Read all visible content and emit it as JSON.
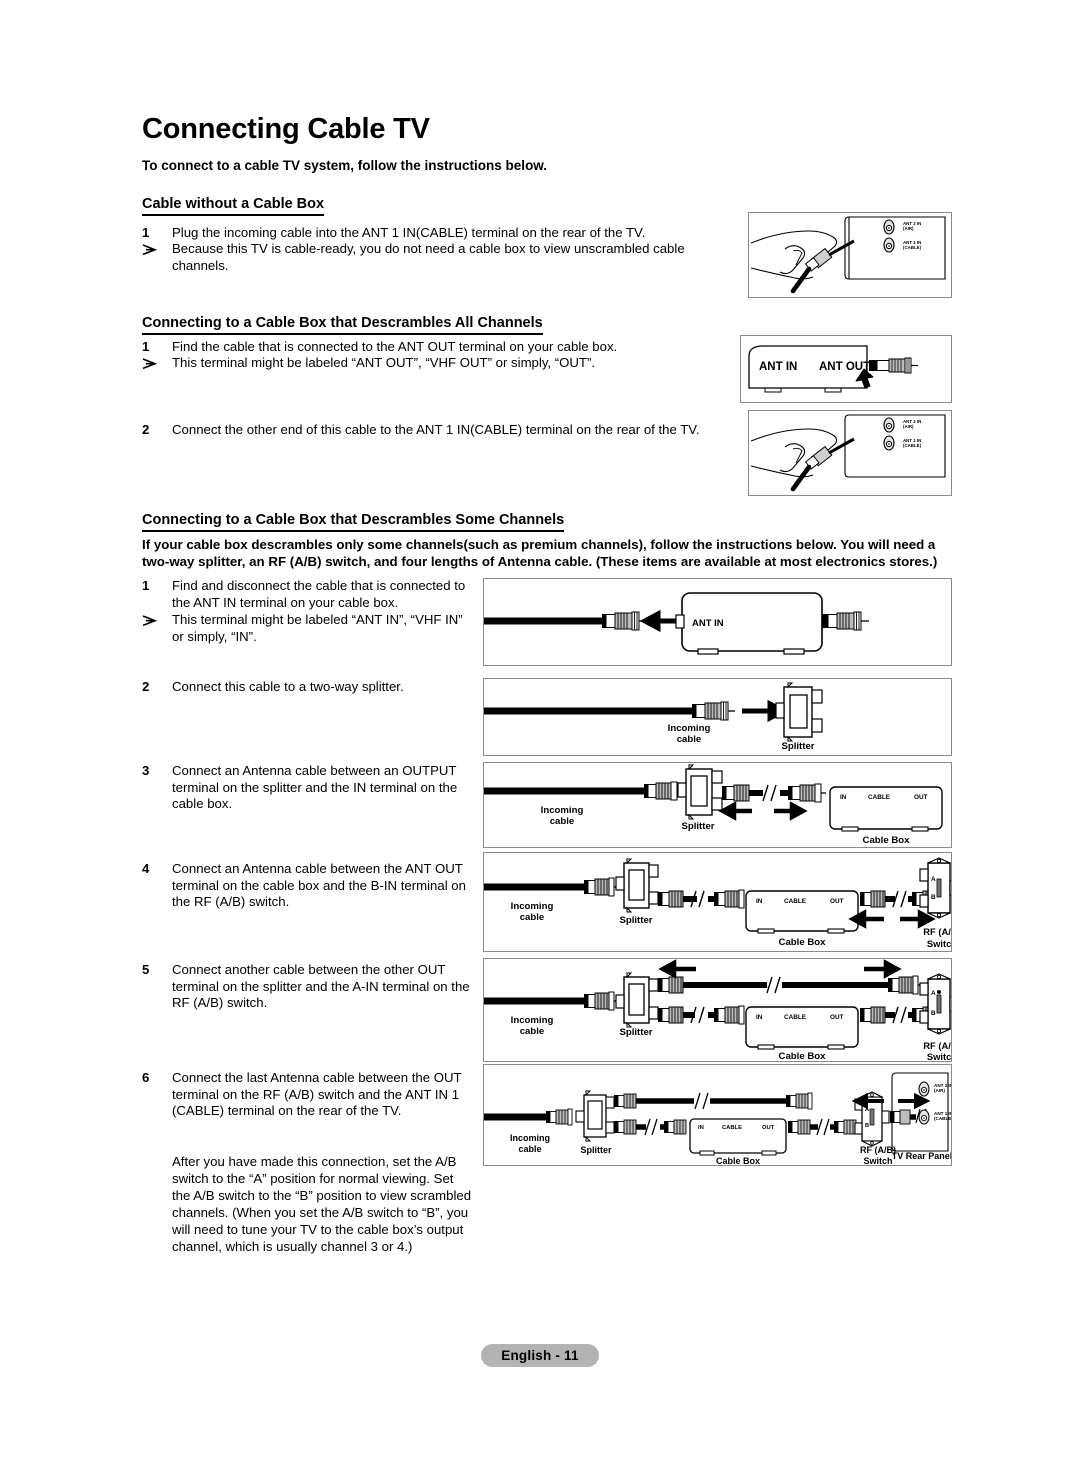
{
  "document": {
    "title": "Connecting Cable TV",
    "lead": "To connect to a cable TV system, follow the instructions below.",
    "footer_label": "English - 11"
  },
  "sections": [
    {
      "id": "without-cable-box",
      "heading": "Cable without a Cable Box",
      "steps": [
        {
          "marker": "1",
          "type": "number",
          "text": "Plug the incoming cable into the ANT 1 IN(CABLE) terminal on the rear of the TV."
        },
        {
          "marker": "➢",
          "type": "arrow",
          "text": "Because this TV is cable-ready, you do not need a cable box to view unscrambled cable channels."
        }
      ]
    },
    {
      "id": "descrambles-all",
      "heading": "Connecting to a Cable Box that Descrambles All Channels",
      "steps": [
        {
          "marker": "1",
          "type": "number",
          "text": "Find the cable that is connected to the ANT OUT terminal on your cable box."
        },
        {
          "marker": "➢",
          "type": "arrow",
          "text": "This terminal might be labeled “ANT OUT”, “VHF OUT” or simply, “OUT”."
        },
        {
          "marker": "2",
          "type": "number",
          "text": "Connect the other end of this cable to the ANT 1 IN(CABLE) terminal on the rear of the TV."
        }
      ]
    },
    {
      "id": "descrambles-some",
      "heading": "Connecting to a Cable Box that Descrambles Some Channels",
      "intro": "If your cable box descrambles only some channels(such as premium channels), follow the instructions below. You will need a two-way splitter, an RF (A/B) switch, and four lengths of Antenna cable. (These items are available at most electronics stores.)",
      "steps": [
        {
          "marker": "1",
          "type": "number",
          "text": "Find and disconnect the cable that is connected to the ANT IN terminal on your cable box."
        },
        {
          "marker": "➢",
          "type": "arrow",
          "text": "This terminal might be labeled “ANT IN”, “VHF IN” or simply, “IN”."
        },
        {
          "marker": "2",
          "type": "number",
          "text": "Connect this cable to a two-way splitter."
        },
        {
          "marker": "3",
          "type": "number",
          "text": "Connect an Antenna cable between an OUTPUT terminal on the splitter and the IN terminal on the cable box."
        },
        {
          "marker": "4",
          "type": "number",
          "text": "Connect an Antenna cable between the ANT OUT terminal on the cable box and the B-IN terminal on the RF (A/B) switch."
        },
        {
          "marker": "5",
          "type": "number",
          "text": "Connect another cable between the other OUT terminal on the splitter and the A-IN terminal on the RF (A/B) switch."
        },
        {
          "marker": "6",
          "type": "number",
          "text": "Connect the last Antenna cable between the OUT terminal on the RF (A/B) switch and the ANT IN 1 (CABLE) terminal on the rear of the TV."
        }
      ],
      "closing": "After you have made this connection, set the A/B switch to the “A” position for normal viewing. Set the A/B switch to the “B” position to view scrambled channels. (When you set the A/B switch to “B”, you will need to tune your TV to the cable box’s output channel, which is usually channel 3 or 4.)"
    }
  ],
  "diagrams": [
    {
      "id": "tv-rear-hand-1",
      "caption": "",
      "labels": {
        "ant2": "ANT 2 IN",
        "ant2sub": "(AIR)",
        "ant1": "ANT 1 IN",
        "ant1sub": "(CABLE)"
      }
    },
    {
      "id": "cable-box-ant-out",
      "labels": {
        "ant_in": "ANT IN",
        "ant_out": "ANT OUT"
      }
    },
    {
      "id": "tv-rear-hand-2",
      "labels": {
        "ant2": "ANT 2 IN",
        "ant2sub": "(AIR)",
        "ant1": "ANT 1 IN",
        "ant1sub": "(CABLE)"
      }
    },
    {
      "id": "step1-disconnect",
      "labels": {
        "ant_in": "ANT IN"
      }
    },
    {
      "id": "step2-splitter",
      "labels": {
        "incoming1": "Incoming",
        "incoming2": "cable",
        "splitter": "Splitter"
      }
    },
    {
      "id": "step3-cable-box",
      "labels": {
        "incoming1": "Incoming",
        "incoming2": "cable",
        "splitter": "Splitter",
        "in": "IN",
        "cable": "CABLE",
        "out": "OUT",
        "cable_box": "Cable Box"
      }
    },
    {
      "id": "step4-rf-switch",
      "labels": {
        "incoming1": "Incoming",
        "incoming2": "cable",
        "splitter": "Splitter",
        "in": "IN",
        "cable": "CABLE",
        "out": "OUT",
        "cable_box": "Cable Box",
        "rf1": "RF (A/B)",
        "rf2": "Switch",
        "sw_a": "A",
        "sw_b": "B"
      }
    },
    {
      "id": "step5-second-cable",
      "labels": {
        "incoming1": "Incoming",
        "incoming2": "cable",
        "splitter": "Splitter",
        "in": "IN",
        "cable": "CABLE",
        "out": "OUT",
        "cable_box": "Cable Box",
        "rf1": "RF (A/B)",
        "rf2": "Switch",
        "sw_a": "A",
        "sw_b": "B"
      }
    },
    {
      "id": "step6-tv-rear-panel",
      "labels": {
        "incoming1": "Incoming",
        "incoming2": "cable",
        "splitter": "Splitter",
        "in": "IN",
        "cable": "CABLE",
        "out": "OUT",
        "cable_box": "Cable Box",
        "rf1": "RF (A/B)",
        "rf2": "Switch",
        "sw_a": "A",
        "sw_b": "B",
        "tv_rear": "TV Rear Panel",
        "ant2": "ANT 2 IN",
        "ant2sub": "(AIR)",
        "ant1": "ANT 1 IN",
        "ant1sub": "(CABLE)"
      }
    }
  ],
  "colors": {
    "text": "#000000",
    "frame_border": "#8a8a8a",
    "footer_pill": "#b3b3b3",
    "cable": "#000000"
  }
}
